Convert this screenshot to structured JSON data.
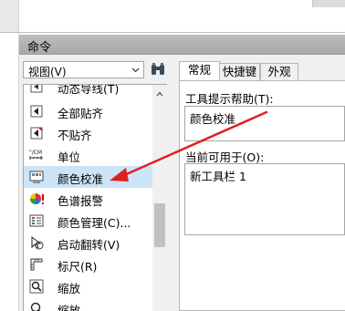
{
  "dialog": {
    "title": "命令"
  },
  "view_select": {
    "value": "视图(V)"
  },
  "commands": [
    {
      "label": "动态导线(T)",
      "icon": "dynamic-guides-icon"
    },
    {
      "label": "全部贴齐",
      "icon": "snap-all-icon"
    },
    {
      "label": "不贴齐",
      "icon": "snap-off-icon"
    },
    {
      "label": "单位",
      "icon": "units-icon",
      "icon_text": "\"/CM"
    },
    {
      "label": "颜色校准",
      "icon": "color-proofing-icon",
      "selected": true
    },
    {
      "label": "色谱报警",
      "icon": "gamut-alarm-icon"
    },
    {
      "label": "颜色管理(C)...",
      "icon": "color-management-icon"
    },
    {
      "label": "启动翻转(V)",
      "icon": "rollover-icon"
    },
    {
      "label": "标尺(R)",
      "icon": "rulers-icon"
    },
    {
      "label": "缩放",
      "icon": "zoom-icon"
    },
    {
      "label": "缩放",
      "icon": "zoom-icon"
    }
  ],
  "tabs": [
    {
      "label": "常规"
    },
    {
      "label": "快捷键"
    },
    {
      "label": "外观"
    }
  ],
  "tooltip_help": {
    "label": "工具提示帮助(T):",
    "value": "颜色校准"
  },
  "available_in": {
    "label": "当前可用于(O):",
    "value": "新工具栏 1"
  },
  "colors": {
    "selection": "#cce4f7",
    "annotation_arrow": "#e02020"
  }
}
